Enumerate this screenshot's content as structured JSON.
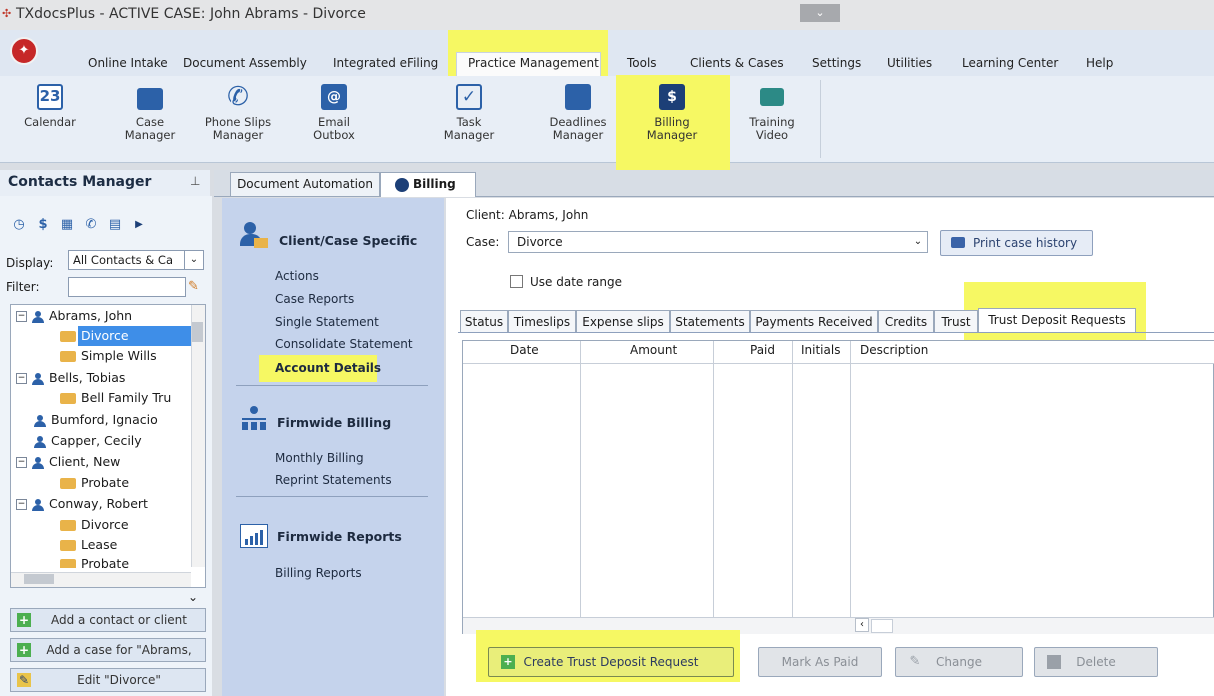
{
  "window": {
    "title": "TXdocsPlus - ACTIVE CASE: John Abrams - Divorce"
  },
  "menu": [
    {
      "label": "Online Intake"
    },
    {
      "label": "Document Assembly"
    },
    {
      "label": "Integrated eFiling"
    },
    {
      "label": "Practice Management",
      "active": true
    },
    {
      "label": "Tools"
    },
    {
      "label": "Clients & Cases"
    },
    {
      "label": "Settings"
    },
    {
      "label": "Utilities"
    },
    {
      "label": "Learning Center"
    },
    {
      "label": "Help"
    }
  ],
  "ribbon": [
    {
      "label": "Calendar",
      "icon": "calendar-icon",
      "badge": "23"
    },
    {
      "label": "Case\nManager",
      "icon": "briefcase-icon"
    },
    {
      "label": "Phone Slips\nManager",
      "icon": "phone-icon"
    },
    {
      "label": "Email\nOutbox",
      "icon": "email-icon"
    },
    {
      "label": "Task\nManager",
      "icon": "task-icon"
    },
    {
      "label": "Deadlines\nManager",
      "icon": "deadlines-icon"
    },
    {
      "label": "Billing\nManager",
      "icon": "billing-icon",
      "highlighted": true
    },
    {
      "label": "Training\nVideo",
      "icon": "video-icon"
    }
  ],
  "contacts": {
    "title": "Contacts Manager",
    "display_label": "Display:",
    "display_value": "All Contacts & Ca",
    "filter_label": "Filter:",
    "filter_value": "",
    "tree": [
      {
        "type": "person",
        "label": "Abrams, John",
        "expanded": true
      },
      {
        "type": "case",
        "label": "Divorce",
        "selected": true
      },
      {
        "type": "case",
        "label": "Simple Wills"
      },
      {
        "type": "person",
        "label": "Bells, Tobias",
        "expanded": true
      },
      {
        "type": "case",
        "label": "Bell Family Tru"
      },
      {
        "type": "person",
        "label": "Bumford, Ignacio"
      },
      {
        "type": "person",
        "label": "Capper, Cecily"
      },
      {
        "type": "person",
        "label": "Client, New",
        "expanded": true
      },
      {
        "type": "case",
        "label": "Probate"
      },
      {
        "type": "person",
        "label": "Conway, Robert",
        "expanded": true
      },
      {
        "type": "case",
        "label": "Divorce"
      },
      {
        "type": "case",
        "label": "Lease"
      },
      {
        "type": "case",
        "label": "Probate"
      }
    ],
    "buttons": [
      {
        "label": "Add a contact or client"
      },
      {
        "label": "Add a case for \"Abrams,"
      },
      {
        "label": "Edit \"Divorce\""
      }
    ]
  },
  "doc_tabs": [
    {
      "label": "Document Automation"
    },
    {
      "label": "Billing",
      "active": true,
      "close": "×"
    }
  ],
  "billing_nav": {
    "sections": [
      {
        "title": "Client/Case Specific",
        "icon": "client-case-icon",
        "items": [
          "Actions",
          "Case Reports",
          "Single Statement",
          "Consolidate Statement",
          "Account Details"
        ]
      },
      {
        "title": "Firmwide Billing",
        "icon": "firmwide-billing-icon",
        "items": [
          "Monthly Billing",
          "Reprint Statements"
        ]
      },
      {
        "title": "Firmwide Reports",
        "icon": "firmwide-reports-icon",
        "items": [
          "Billing Reports"
        ]
      }
    ],
    "active_item": "Account Details"
  },
  "case_info": {
    "client_label": "Client:",
    "client_value": "Abrams, John",
    "case_label": "Case:",
    "case_value": "Divorce",
    "print_button": "Print case history",
    "date_range_label": "Use date range",
    "date_range_checked": false
  },
  "sub_tabs": [
    "Status",
    "Timeslips",
    "Expense slips",
    "Statements",
    "Payments Received",
    "Credits",
    "Trust",
    "Trust Deposit Requests"
  ],
  "active_sub_tab": "Trust Deposit Requests",
  "grid": {
    "columns": [
      "Date",
      "Amount",
      "Paid",
      "Initials",
      "Description"
    ],
    "rows": []
  },
  "actions": {
    "create": "Create Trust Deposit Request",
    "mark_paid": "Mark As Paid",
    "change": "Change",
    "delete": "Delete"
  },
  "colors": {
    "highlight": "#f6f863",
    "selection": "#3e8ee8",
    "accent": "#2c61a8"
  }
}
